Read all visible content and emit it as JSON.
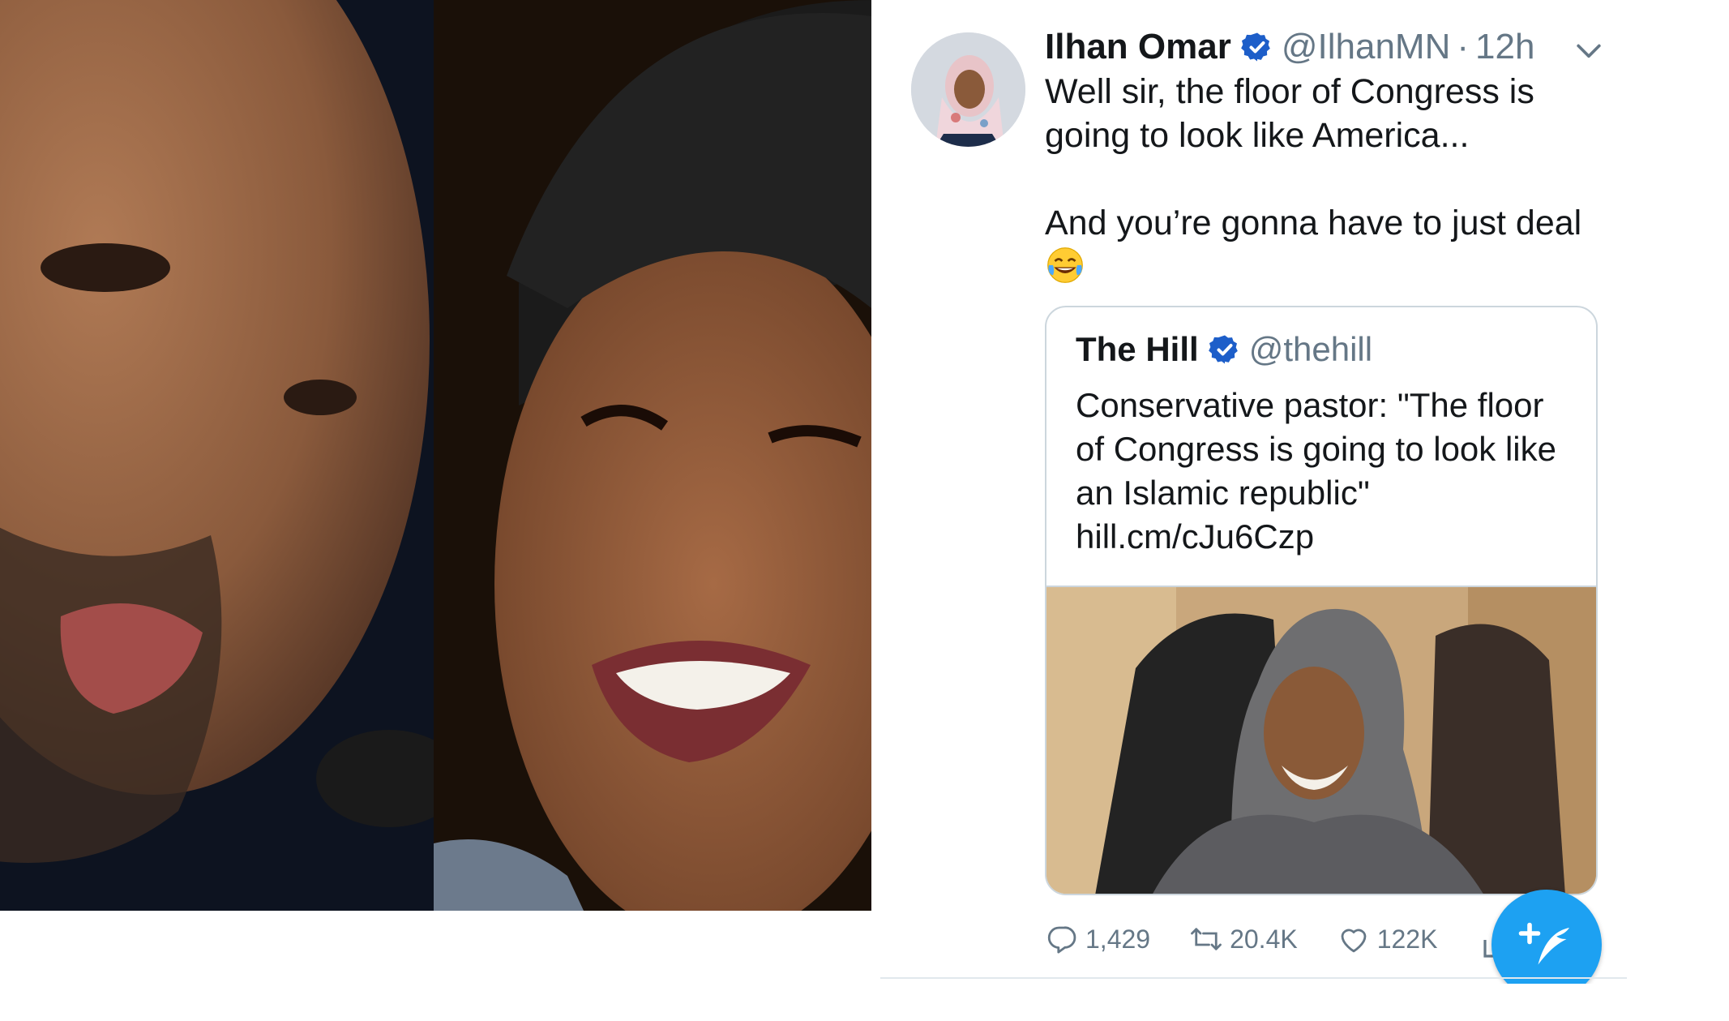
{
  "tweet": {
    "display_name": "Ilhan Omar",
    "handle": "@IlhanMN",
    "separator": "·",
    "time": "12h",
    "body_line1": "Well sir, the floor of Congress is going to look like America...",
    "body_line2": "And you’re gonna have to just deal",
    "emoji": "face-with-tears-of-joy"
  },
  "quote": {
    "display_name": "The Hill",
    "handle": "@thehill",
    "text": "Conservative pastor: \"The floor of Congress is going to look like an Islamic republic\"",
    "link": "hill.cm/cJu6Czp"
  },
  "actions": {
    "replies": "1,429",
    "retweets": "20.4K",
    "likes": "122K"
  },
  "colors": {
    "accent": "#1da1f2",
    "verified": "#1d5ec9",
    "muted_text": "#657786",
    "border": "#ccd6dd"
  },
  "icons": [
    "verified-badge-icon",
    "chevron-down-icon",
    "reply-icon",
    "retweet-icon",
    "like-icon",
    "share-icon",
    "compose-tweet-icon"
  ]
}
